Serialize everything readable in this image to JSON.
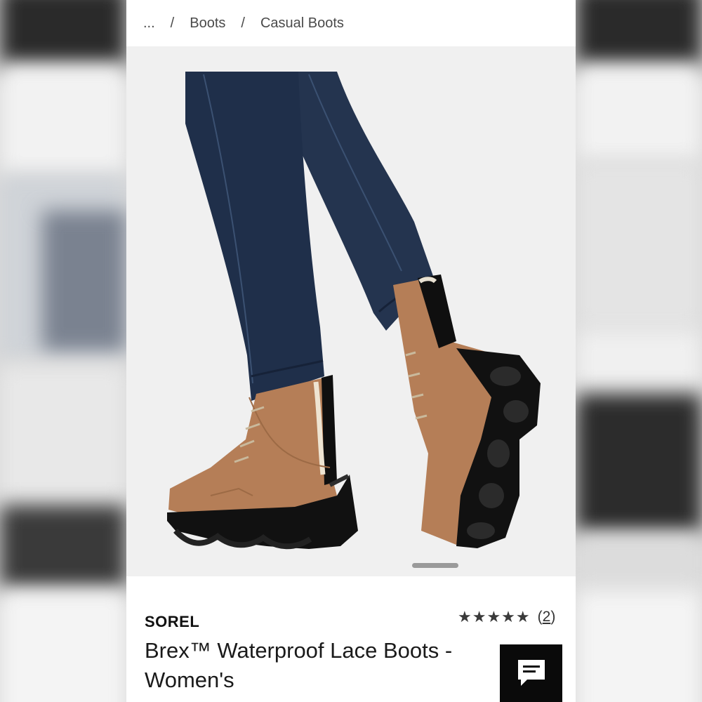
{
  "breadcrumb": {
    "items": [
      "...",
      "Boots",
      "Casual Boots"
    ],
    "separator": "/"
  },
  "product": {
    "brand": "SOREL",
    "title": "Brex™ Waterproof Lace Boots - Women's",
    "rating_stars": "★★★★★",
    "rating_value": 5,
    "review_count_open": "(",
    "review_count": "2",
    "review_count_close": ")",
    "image_index": 1
  },
  "icons": {
    "chat": "chat-bubble-icon"
  },
  "colors": {
    "panel_bg": "#ffffff",
    "gallery_bg": "#f0f0f0",
    "boot_leather": "#b57e57",
    "sole": "#111111",
    "denim": "#22324d",
    "chat_button_bg": "#0a0a0a"
  }
}
